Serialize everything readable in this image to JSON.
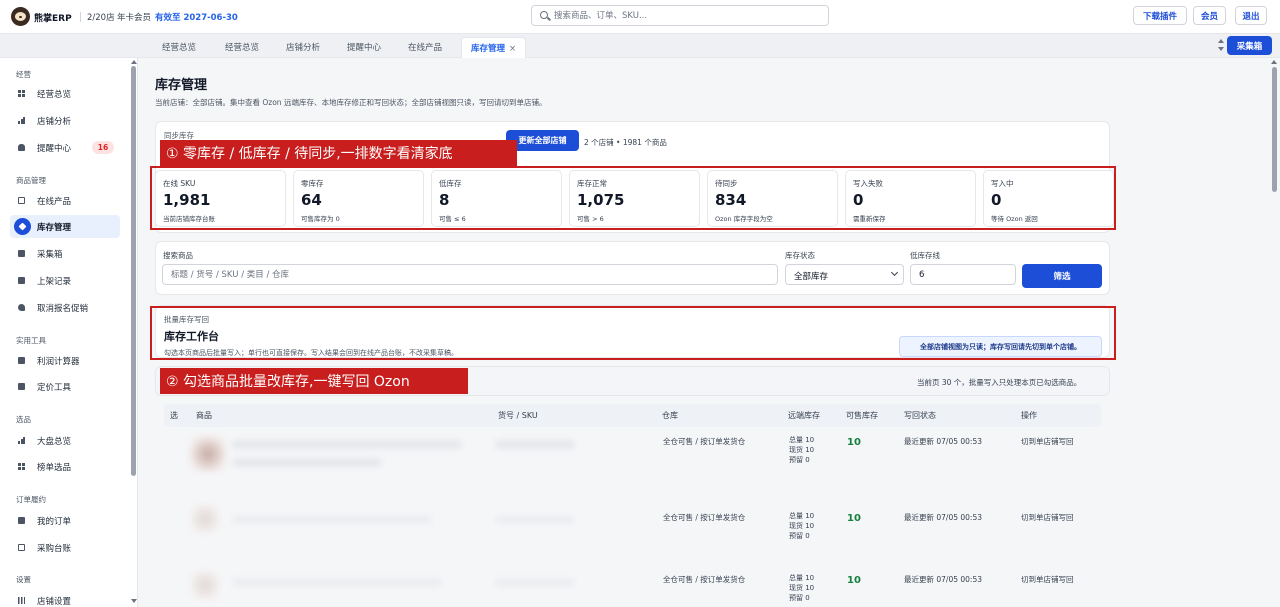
{
  "header": {
    "brand": "熊掌ERP",
    "store_count": "2/20店",
    "member": "年卡会员",
    "validity": "有效至 2027-06-30",
    "search_placeholder": "搜索商品、订单、SKU...",
    "download_plugin": "下载插件",
    "membership": "会员",
    "logout": "退出"
  },
  "tabs": [
    {
      "label": "经营总览"
    },
    {
      "label": "经营总览"
    },
    {
      "label": "店铺分析"
    },
    {
      "label": "提醒中心"
    },
    {
      "label": "在线产品"
    },
    {
      "label": "库存管理",
      "active": true
    }
  ],
  "tab_close": "×",
  "collect_button": "采集箱",
  "sidebar": {
    "groups": [
      {
        "label": "经营"
      },
      {
        "label": "商品管理"
      },
      {
        "label": "实用工具"
      },
      {
        "label": "选品"
      },
      {
        "label": "订单履约"
      },
      {
        "label": "设置"
      }
    ],
    "items": [
      {
        "label": "经营总览",
        "icon": "grid-icon"
      },
      {
        "label": "店铺分析",
        "icon": "bar-chart-icon"
      },
      {
        "label": "提醒中心",
        "icon": "bell-icon",
        "badge": "16"
      },
      {
        "label": "在线产品",
        "icon": "box-icon"
      },
      {
        "label": "库存管理",
        "icon": "layers-icon",
        "active": true
      },
      {
        "label": "采集箱",
        "icon": "inbox-icon"
      },
      {
        "label": "上架记录",
        "icon": "document-icon"
      },
      {
        "label": "取消报名促销",
        "icon": "tag-icon"
      },
      {
        "label": "利润计算器",
        "icon": "calculator-icon"
      },
      {
        "label": "定价工具",
        "icon": "calculator-icon"
      },
      {
        "label": "大盘总览",
        "icon": "bar-chart-icon"
      },
      {
        "label": "榜单选品",
        "icon": "grid-icon"
      },
      {
        "label": "我的订单",
        "icon": "document-icon"
      },
      {
        "label": "采购台账",
        "icon": "book-icon"
      },
      {
        "label": "店铺设置",
        "icon": "sliders-icon"
      }
    ]
  },
  "page": {
    "title": "库存管理",
    "description": "当前店铺：全部店铺。集中查看 Ozon 远端库存、本地库存修正和写回状态；全部店铺视图只读，写回请切到单店铺。"
  },
  "sync": {
    "label": "同步库存",
    "button": "更新全部店铺",
    "meta": "2 个店铺 • 1981 个商品"
  },
  "annotations": {
    "first": "① 零库存 / 低库存 / 待同步,一排数字看清家底",
    "second": "② 勾选商品批量改库存,一键写回 Ozon"
  },
  "stats": [
    {
      "label": "在线 SKU",
      "value": "1,981",
      "sub": "当前店铺库存台账"
    },
    {
      "label": "零库存",
      "value": "64",
      "sub": "可售库存为 0"
    },
    {
      "label": "低库存",
      "value": "8",
      "sub": "可售 ≤ 6"
    },
    {
      "label": "库存正常",
      "value": "1,075",
      "sub": "可售 > 6"
    },
    {
      "label": "待同步",
      "value": "834",
      "sub": "Ozon 库存字段为空"
    },
    {
      "label": "写入失败",
      "value": "0",
      "sub": "需重新保存"
    },
    {
      "label": "写入中",
      "value": "0",
      "sub": "等待 Ozon 返回"
    }
  ],
  "filters": {
    "search_label": "搜索商品",
    "search_placeholder": "标题 / 货号 / SKU / 类目 / 仓库",
    "status_label": "库存状态",
    "status_value": "全部库存",
    "low_label": "低库存线",
    "low_value": "6",
    "filter_button": "筛选"
  },
  "bulk": {
    "label": "批量库存写回",
    "title": "库存工作台",
    "description": "勾选本页商品后批量写入；单行也可直接保存。写入结果会回到在线产品台账，不改采集草稿。",
    "readonly_notice": "全部店铺视图为只读；库存写回请先切到单个店铺。",
    "page_info": "当前页 30 个，批量写入只处理本页已勾选商品。"
  },
  "table": {
    "columns": [
      "选",
      "商品",
      "货号 / SKU",
      "仓库",
      "远端库存",
      "可售库存",
      "写回状态",
      "操作"
    ],
    "rows": [
      {
        "warehouse": "全仓可售 / 按订单发货仓",
        "stock_total": "总量 10",
        "stock_current": "现货 10",
        "stock_reserved": "预留 0",
        "available": "10",
        "status": "最近更新 07/05 00:53",
        "action": "切到单店铺写回"
      },
      {
        "warehouse": "全仓可售 / 按订单发货仓",
        "stock_total": "总量 10",
        "stock_current": "现货 10",
        "stock_reserved": "预留 0",
        "available": "10",
        "status": "最近更新 07/05 00:53",
        "action": "切到单店铺写回"
      },
      {
        "warehouse": "全仓可售 / 按订单发货仓",
        "stock_total": "总量 10",
        "stock_current": "现货 10",
        "stock_reserved": "预留 0",
        "available": "10",
        "status": "最近更新 07/05 00:53",
        "action": "切到单店铺写回"
      }
    ]
  },
  "colors": {
    "accent": "#1d4ed8",
    "annotation": "#c81e1e",
    "available": "#15803d",
    "badge": "#dc2626"
  }
}
